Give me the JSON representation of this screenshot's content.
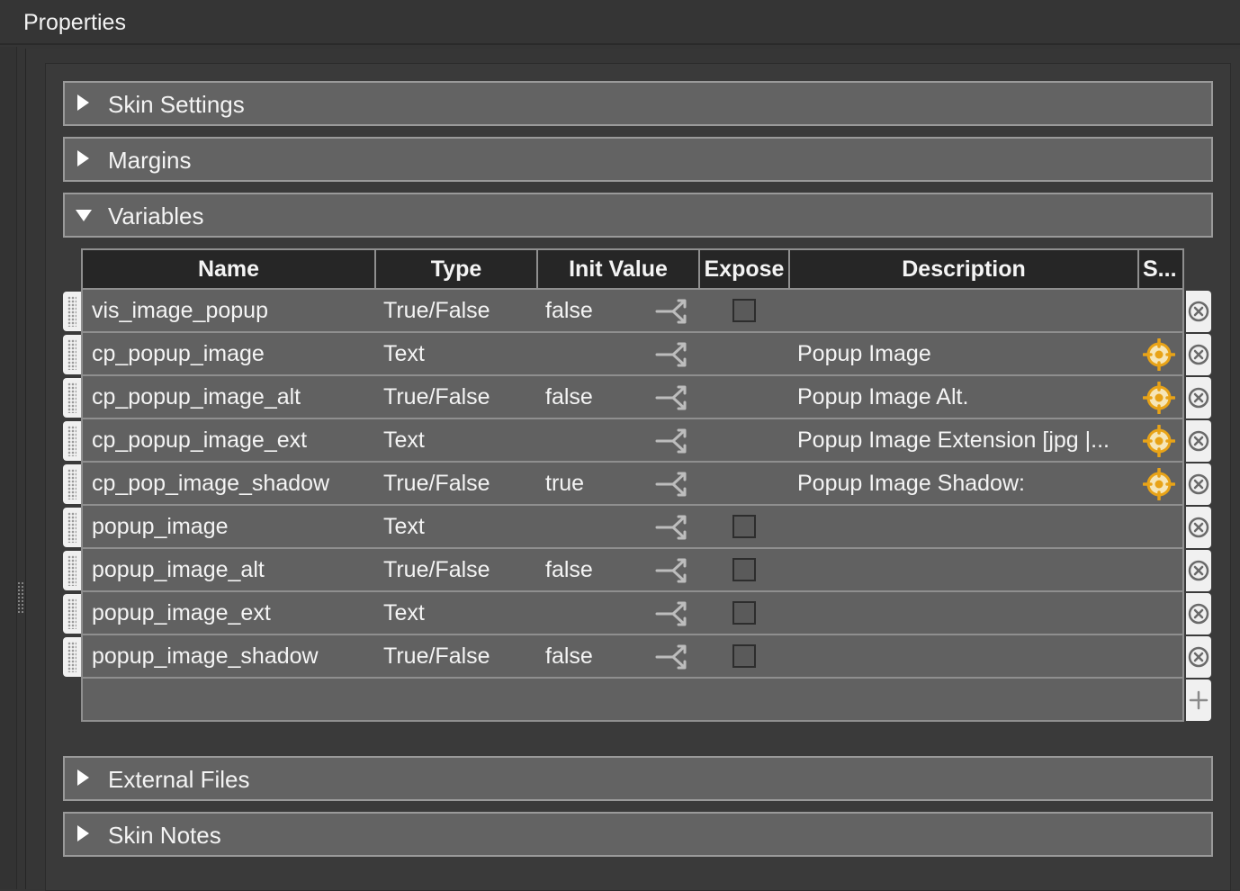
{
  "panel": {
    "title": "Properties"
  },
  "sections": {
    "skin_settings": "Skin Settings",
    "margins": "Margins",
    "variables": "Variables",
    "external_files": "External Files",
    "skin_notes": "Skin Notes"
  },
  "table": {
    "columns": {
      "name": "Name",
      "type": "Type",
      "init_value": "Init Value",
      "expose": "Expose",
      "description": "Description",
      "s": "S..."
    },
    "rows": [
      {
        "name": "vis_image_popup",
        "type": "True/False",
        "init": "false",
        "expose": "checkbox",
        "description": "",
        "skin_setting": false
      },
      {
        "name": "cp_popup_image",
        "type": "Text",
        "init": "",
        "expose": "none",
        "description": "Popup Image",
        "skin_setting": true
      },
      {
        "name": "cp_popup_image_alt",
        "type": "True/False",
        "init": "false",
        "expose": "none",
        "description": "Popup Image Alt.",
        "skin_setting": true
      },
      {
        "name": "cp_popup_image_ext",
        "type": "Text",
        "init": "",
        "expose": "none",
        "description": "Popup Image Extension [jpg |...",
        "skin_setting": true
      },
      {
        "name": "cp_pop_image_shadow",
        "type": "True/False",
        "init": "true",
        "expose": "none",
        "description": "Popup Image Shadow:",
        "skin_setting": true
      },
      {
        "name": "popup_image",
        "type": "Text",
        "init": "",
        "expose": "checkbox",
        "description": "",
        "skin_setting": false
      },
      {
        "name": "popup_image_alt",
        "type": "True/False",
        "init": "false",
        "expose": "checkbox",
        "description": "",
        "skin_setting": false
      },
      {
        "name": "popup_image_ext",
        "type": "Text",
        "init": "",
        "expose": "checkbox",
        "description": "",
        "skin_setting": false
      },
      {
        "name": "popup_image_shadow",
        "type": "True/False",
        "init": "false",
        "expose": "checkbox",
        "description": "",
        "skin_setting": false
      }
    ]
  },
  "icons": {
    "expand": "triangle-right-icon",
    "collapse": "triangle-down-icon",
    "link": "link-arrows-icon",
    "remove": "close-circle-icon",
    "target": "target-crosshair-icon",
    "add": "plus-icon",
    "drag": "drag-handle-icon"
  },
  "colors": {
    "accent": "#e8a317",
    "section_bg": "#636363",
    "header_bg": "#262626"
  }
}
